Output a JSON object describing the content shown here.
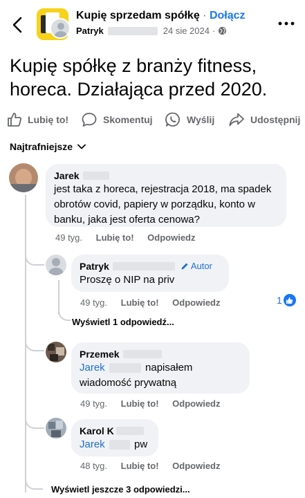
{
  "header": {
    "group_name": "Kupię sprzedam spółkę",
    "separator": "·",
    "join_label": "Dołącz",
    "author": "Patryk",
    "date": "24 sie 2024",
    "separator2": "·"
  },
  "post": {
    "text": "Kupię spółkę z branży fitness, horeca. Działająca przed 2020."
  },
  "actions": {
    "like": "Lubię to!",
    "comment": "Skomentuj",
    "send": "Wyślij",
    "share": "Udostępnij"
  },
  "sort_label": "Najtrafniejsze",
  "comments": [
    {
      "name": "Jarek",
      "text": "jest taka z horeca, rejestracja 2018, ma spadek obrotów covid, papiery w porządku, konto w banku, jaka jest oferta cenowa?",
      "age": "49 tyg.",
      "like": "Lubię to!",
      "reply": "Odpowiedz"
    }
  ],
  "replies": [
    {
      "name": "Patryk",
      "badge": "Autor",
      "text": "Proszę o NIP na priv",
      "age": "49 tyg.",
      "like": "Lubię to!",
      "reply": "Odpowiedz",
      "reaction_count": "1",
      "view_more": "Wyświetl 1 odpowiedź..."
    },
    {
      "name": "Przemek",
      "mention": "Jarek",
      "text": "napisałem wiadomość prywatną",
      "age": "49 tyg.",
      "like": "Lubię to!",
      "reply": "Odpowiedz"
    },
    {
      "name": "Karol K",
      "mention": "Jarek",
      "text": "pw",
      "age": "48 tyg.",
      "like": "Lubię to!",
      "reply": "Odpowiedz"
    }
  ],
  "view_more_bottom": "Wyświetl jeszcze 3 odpowiedzi...",
  "colors": {
    "accent": "#1877f2",
    "bubble": "#f0f2f5",
    "muted": "#65676b",
    "mention": "#1f6fd1"
  },
  "icons": [
    "back-arrow-icon",
    "globe-icon",
    "more-icon",
    "like-icon",
    "comment-icon",
    "whatsapp-icon",
    "share-icon",
    "chevron-down-icon",
    "pencil-icon",
    "like-reaction-icon"
  ]
}
